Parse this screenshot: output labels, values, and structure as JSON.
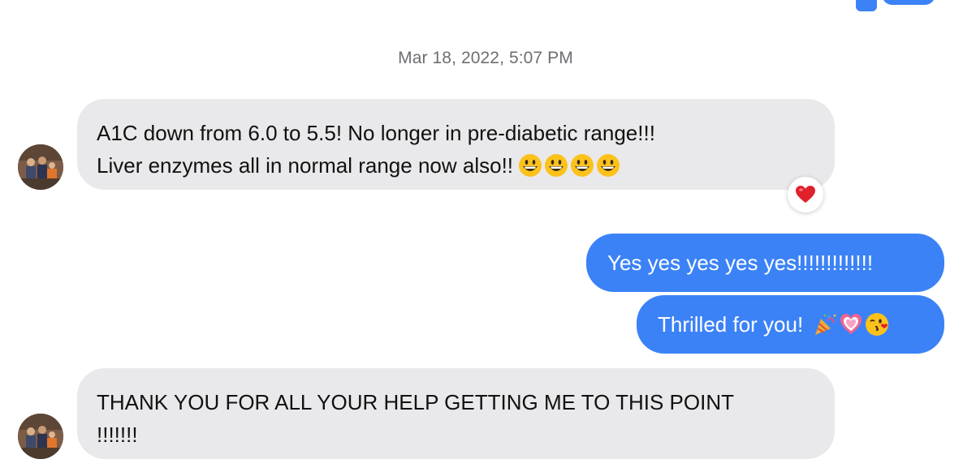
{
  "conversation": {
    "timestamp": "Mar 18, 2022, 5:07 PM",
    "messages": [
      {
        "direction": "incoming",
        "lines": [
          "A1C down from 6.0 to 5.5! No longer in pre-diabetic range!!!",
          "Liver enzymes all in normal range now also!!"
        ],
        "emojis": [
          "grinning-face",
          "grinning-face",
          "grinning-face",
          "grinning-face"
        ],
        "reaction": "heart"
      },
      {
        "direction": "outgoing",
        "text": "Yes yes yes yes yes!!!!!!!!!!!!!"
      },
      {
        "direction": "outgoing",
        "text": "Thrilled for you!",
        "emojis": [
          "party-popper",
          "sparkling-heart",
          "face-blowing-kiss"
        ]
      },
      {
        "direction": "incoming",
        "lines": [
          "THANK YOU FOR ALL YOUR HELP GETTING ME TO THIS POINT",
          "!!!!!!!"
        ]
      }
    ]
  },
  "colors": {
    "incoming_bubble": "#e9e9eb",
    "outgoing_bubble": "#3b82f6",
    "timestamp_text": "#6e6e73",
    "reaction_heart": "#e0202a"
  }
}
